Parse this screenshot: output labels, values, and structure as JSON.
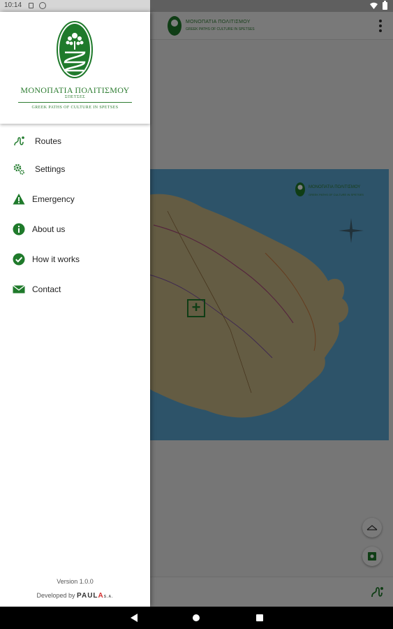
{
  "status_bar": {
    "time": "10:14",
    "icons": [
      "sim-icon",
      "sync-icon",
      "wifi-icon",
      "battery-icon"
    ]
  },
  "brand": {
    "title": "ΜΟΝΟΠΑΤΙΑ ΠΟΛΙΤΙΣΜΟΥ",
    "area": "ΣΠΕΤΣΕΣ",
    "subtitle": "GREEK PATHS OF CULTURE IN SPETSES",
    "color": "#2e7d32"
  },
  "menu": {
    "items": [
      {
        "label": "Routes",
        "icon": "route-icon"
      },
      {
        "label": "Settings",
        "icon": "settings-icon"
      },
      {
        "label": "Emergency",
        "icon": "warning-icon"
      },
      {
        "label": "About us",
        "icon": "info-icon"
      },
      {
        "label": "How it works",
        "icon": "check-circle-icon"
      },
      {
        "label": "Contact",
        "icon": "mail-icon"
      }
    ]
  },
  "footer": {
    "version": "Version 1.0.0",
    "developed_by": "Developed by",
    "developer_a": "PAUL",
    "developer_b": "A",
    "developer_suffix": "S.A."
  },
  "map_card": {
    "title": "ΜΟΝΟΠΑΤΙΑ ΠΟΛΙΤΙΣΜΟΥ",
    "subtitle": "GREEK PATHS OF CULTURE IN SPETSES"
  },
  "colors": {
    "accent": "#1f7a2b",
    "sea": "#5aa7d3",
    "scrim": "rgba(0,0,0,0.5)"
  }
}
